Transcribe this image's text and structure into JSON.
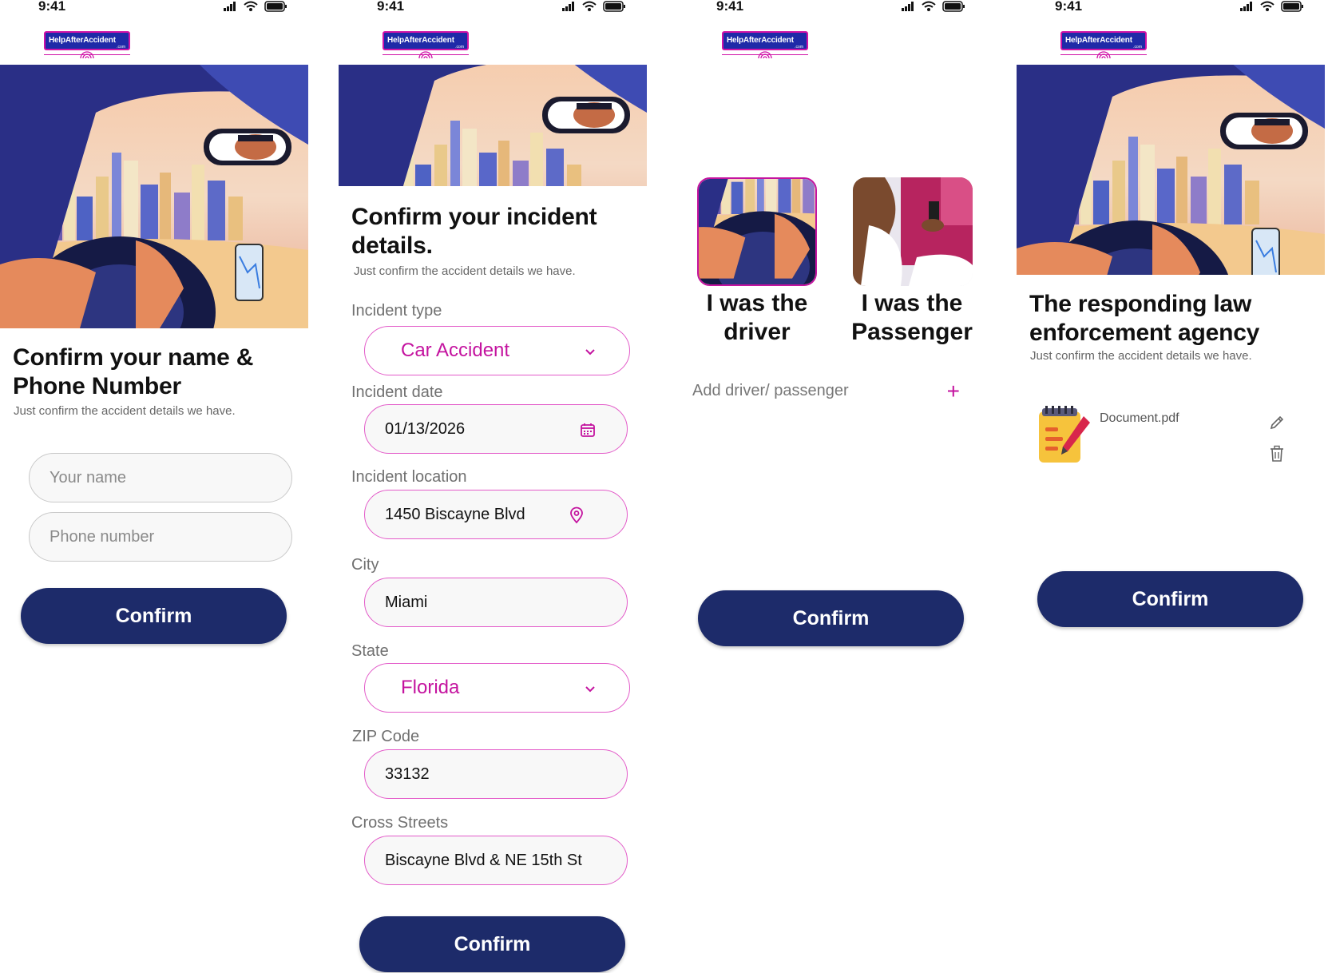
{
  "status": {
    "time": "9:41"
  },
  "logo": {
    "text": "HelpAfterAccident",
    "sub": ".com"
  },
  "screen1": {
    "title_line1": "Confirm your name &",
    "title_line2": "Phone Number",
    "subtitle": "Just confirm the accident details we have.",
    "name_placeholder": "Your name",
    "phone_placeholder": "Phone number",
    "confirm_label": "Confirm"
  },
  "screen2": {
    "title_line1": "Confirm your incident",
    "title_line2": "details.",
    "subtitle": "Just confirm the accident details we have.",
    "fields": {
      "incident_type": {
        "label": "Incident type",
        "value": "Car Accident"
      },
      "incident_date": {
        "label": "Incident date",
        "value": "01/13/2026"
      },
      "incident_location": {
        "label": "Incident location",
        "value": "1450 Biscayne Blvd"
      },
      "city": {
        "label": "City",
        "value": "Miami"
      },
      "state": {
        "label": "State",
        "value": "Florida"
      },
      "zip": {
        "label": "ZIP Code",
        "value": "33132"
      },
      "cross_streets": {
        "label": "Cross Streets",
        "value": "Biscayne Blvd & NE 15th St"
      }
    },
    "confirm_label": "Confirm"
  },
  "screen3": {
    "driver_line1": "I was the",
    "driver_line2": "driver",
    "passenger_line1": "I was the",
    "passenger_line2": "Passenger",
    "add_label": "Add driver/ passenger",
    "add_symbol": "+",
    "confirm_label": "Confirm"
  },
  "screen4": {
    "title_line1": "The responding law",
    "title_line2": "enforcement agency",
    "subtitle": "Just confirm the accident details we have.",
    "document_name": "Document.pdf",
    "confirm_label": "Confirm"
  },
  "colors": {
    "primary": "#1d2b6a",
    "accent": "#c4139f",
    "field_border": "#e35bc9"
  },
  "icons": [
    "signal-icon",
    "wifi-icon",
    "battery-icon",
    "chevron-down-icon",
    "calendar-icon",
    "location-pin-icon",
    "plus-icon",
    "notepad-icon",
    "pencil-icon",
    "trash-icon"
  ]
}
